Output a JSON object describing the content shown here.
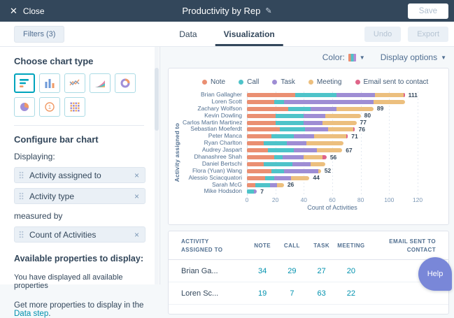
{
  "app": {
    "close_label": "Close",
    "title": "Productivity by Rep",
    "save_label": "Save"
  },
  "toolbar": {
    "filters_label": "Filters (3)",
    "tabs": [
      {
        "label": "Data",
        "active": false
      },
      {
        "label": "Visualization",
        "active": true
      }
    ],
    "undo_label": "Undo",
    "export_label": "Export"
  },
  "sidebar": {
    "chart_type_heading": "Choose chart type",
    "chart_types": [
      "horizontal-bar",
      "vertical-bar",
      "line",
      "area",
      "donut",
      "pie",
      "summary",
      "pivot-table"
    ],
    "selected_chart_type": "horizontal-bar",
    "configure_heading": "Configure bar chart",
    "displaying_label": "Displaying:",
    "dimension_pills": [
      "Activity assigned to",
      "Activity type"
    ],
    "measured_by_label": "measured by",
    "measure_pills": [
      "Count of Activities"
    ],
    "available_heading": "Available properties to display:",
    "available_note": "You have displayed all available properties",
    "more_text_prefix": "Get more properties to display in the ",
    "more_link": "Data step",
    "more_suffix": "."
  },
  "chart_controls": {
    "color_label": "Color:",
    "display_options_label": "Display options"
  },
  "chart_data": {
    "type": "bar",
    "orientation": "horizontal",
    "stacked": true,
    "categories": [
      "Brian Gallagher",
      "Loren Scott",
      "Zachary Wolfson",
      "Kevin Dowling",
      "Carlos Martin Martinez",
      "Sebastian Moeferdt",
      "Peter Manca",
      "Ryan Charlton",
      "Audrey Jaspart",
      "Dhanashree Shah",
      "Daniel Bertschi",
      "Flora (Yuan) Wang",
      "Alessio Sciacquatori",
      "Sarah McG",
      "Mike Hodsdon"
    ],
    "series": [
      {
        "name": "Note",
        "color": "#ea8f72",
        "values": [
          34,
          19,
          29,
          20,
          20,
          23,
          17,
          12,
          15,
          19,
          12,
          17,
          13,
          6,
          0
        ]
      },
      {
        "name": "Call",
        "color": "#4ec3c9",
        "values": [
          29,
          7,
          16,
          20,
          20,
          18,
          16,
          16,
          18,
          6,
          20,
          9,
          6,
          10,
          5
        ]
      },
      {
        "name": "Task",
        "color": "#9e8dd4",
        "values": [
          27,
          63,
          18,
          15,
          13,
          16,
          14,
          14,
          16,
          15,
          13,
          24,
          12,
          5,
          2
        ]
      },
      {
        "name": "Meeting",
        "color": "#ecbf7e",
        "values": [
          20,
          22,
          26,
          25,
          24,
          18,
          23,
          26,
          18,
          13,
          10,
          2,
          13,
          5,
          0
        ]
      },
      {
        "name": "Email sent to contact",
        "color": "#df6589",
        "values": [
          1,
          0,
          0,
          0,
          0,
          1,
          1,
          0,
          0,
          3,
          0,
          0,
          0,
          0,
          0
        ]
      }
    ],
    "total_labels": [
      "111",
      "",
      "89",
      "80",
      "77",
      "76",
      "71",
      "",
      "67",
      "56",
      "",
      "52",
      "44",
      "26",
      "7"
    ],
    "xlabel": "Count of Activities",
    "ylabel": "Activity assigned to",
    "xlim": [
      0,
      120
    ],
    "xticks": [
      0,
      20,
      40,
      60,
      80,
      100,
      120
    ],
    "legend_position": "top",
    "grid": "vertical-dashed"
  },
  "table": {
    "columns": [
      "ACTIVITY ASSIGNED TO",
      "NOTE",
      "CALL",
      "TASK",
      "MEETING",
      "EMAIL SENT TO CONTACT"
    ],
    "rows": [
      {
        "name": "Brian Ga...",
        "values": [
          "34",
          "29",
          "27",
          "20",
          ""
        ]
      },
      {
        "name": "Loren Sc...",
        "values": [
          "19",
          "7",
          "63",
          "22",
          ""
        ]
      }
    ]
  },
  "help": {
    "label": "Help"
  },
  "colors": {
    "topbar": "#33475b",
    "accent": "#00a4bd",
    "link": "#0091ae",
    "background": "#f5f8fa",
    "panel": "#ffffff"
  }
}
